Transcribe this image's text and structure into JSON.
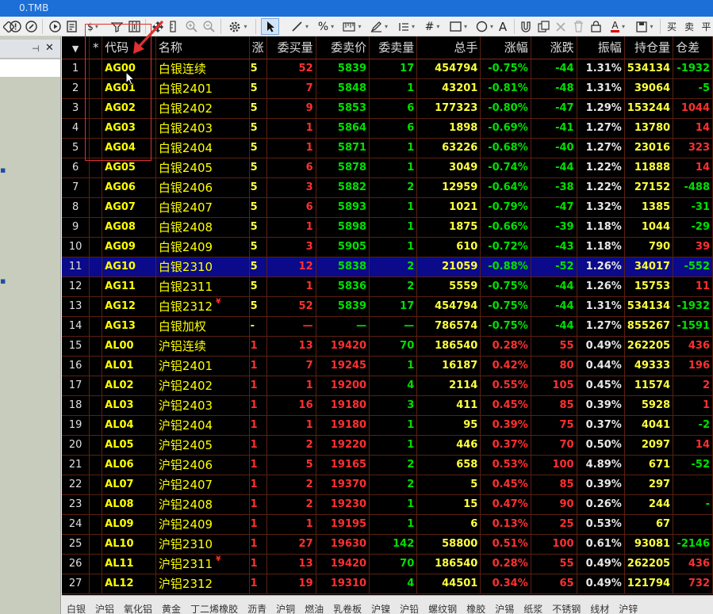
{
  "window": {
    "title": "0.TMB"
  },
  "toolbar": {
    "label_a": "A",
    "label_buy": "买",
    "label_sell": "卖",
    "label_ping": "平"
  },
  "columns": [
    "",
    "*",
    "代码",
    "名称",
    "涨",
    "委买量",
    "委卖价",
    "委卖量",
    "总手",
    "涨幅",
    "涨跌",
    "振幅",
    "持仓量",
    "仓差"
  ],
  "rows": [
    {
      "idx": "1",
      "code": "AG00",
      "name": "白银连续",
      "u": "5",
      "bv": "52",
      "ap": "5839",
      "av": "17",
      "vol": "454794",
      "pct": "-0.75%",
      "chg": "-44",
      "amp": "1.31%",
      "oi": "534134",
      "oid": "-1932",
      "flag": ""
    },
    {
      "idx": "2",
      "code": "AG01",
      "name": "白银2401",
      "u": "5",
      "bv": "7",
      "ap": "5848",
      "av": "1",
      "vol": "43201",
      "pct": "-0.81%",
      "chg": "-48",
      "amp": "1.31%",
      "oi": "39064",
      "oid": "-5",
      "flag": ""
    },
    {
      "idx": "3",
      "code": "AG02",
      "name": "白银2402",
      "u": "5",
      "bv": "9",
      "ap": "5853",
      "av": "6",
      "vol": "177323",
      "pct": "-0.80%",
      "chg": "-47",
      "amp": "1.29%",
      "oi": "153244",
      "oid": "1044",
      "flag": ""
    },
    {
      "idx": "4",
      "code": "AG03",
      "name": "白银2403",
      "u": "5",
      "bv": "1",
      "ap": "5864",
      "av": "6",
      "vol": "1898",
      "pct": "-0.69%",
      "chg": "-41",
      "amp": "1.27%",
      "oi": "13780",
      "oid": "14",
      "flag": ""
    },
    {
      "idx": "5",
      "code": "AG04",
      "name": "白银2404",
      "u": "5",
      "bv": "1",
      "ap": "5871",
      "av": "1",
      "vol": "63226",
      "pct": "-0.68%",
      "chg": "-40",
      "amp": "1.27%",
      "oi": "23016",
      "oid": "323",
      "flag": ""
    },
    {
      "idx": "6",
      "code": "AG05",
      "name": "白银2405",
      "u": "5",
      "bv": "6",
      "ap": "5878",
      "av": "1",
      "vol": "3049",
      "pct": "-0.74%",
      "chg": "-44",
      "amp": "1.22%",
      "oi": "11888",
      "oid": "14",
      "flag": ""
    },
    {
      "idx": "7",
      "code": "AG06",
      "name": "白银2406",
      "u": "5",
      "bv": "3",
      "ap": "5882",
      "av": "2",
      "vol": "12959",
      "pct": "-0.64%",
      "chg": "-38",
      "amp": "1.22%",
      "oi": "27152",
      "oid": "-488",
      "flag": ""
    },
    {
      "idx": "8",
      "code": "AG07",
      "name": "白银2407",
      "u": "5",
      "bv": "6",
      "ap": "5893",
      "av": "1",
      "vol": "1021",
      "pct": "-0.79%",
      "chg": "-47",
      "amp": "1.32%",
      "oi": "1385",
      "oid": "-31",
      "flag": ""
    },
    {
      "idx": "9",
      "code": "AG08",
      "name": "白银2408",
      "u": "5",
      "bv": "1",
      "ap": "5898",
      "av": "1",
      "vol": "1875",
      "pct": "-0.66%",
      "chg": "-39",
      "amp": "1.18%",
      "oi": "1044",
      "oid": "-29",
      "flag": ""
    },
    {
      "idx": "10",
      "code": "AG09",
      "name": "白银2409",
      "u": "5",
      "bv": "3",
      "ap": "5905",
      "av": "1",
      "vol": "610",
      "pct": "-0.72%",
      "chg": "-43",
      "amp": "1.18%",
      "oi": "790",
      "oid": "39",
      "flag": ""
    },
    {
      "idx": "11",
      "code": "AG10",
      "name": "白银2310",
      "u": "5",
      "bv": "12",
      "ap": "5838",
      "av": "2",
      "vol": "21059",
      "pct": "-0.88%",
      "chg": "-52",
      "amp": "1.26%",
      "oi": "34017",
      "oid": "-552",
      "flag": ""
    },
    {
      "idx": "12",
      "code": "AG11",
      "name": "白银2311",
      "u": "5",
      "bv": "1",
      "ap": "5836",
      "av": "2",
      "vol": "5559",
      "pct": "-0.75%",
      "chg": "-44",
      "amp": "1.26%",
      "oi": "15753",
      "oid": "11",
      "flag": ""
    },
    {
      "idx": "13",
      "code": "AG12",
      "name": "白银2312",
      "u": "5",
      "bv": "52",
      "ap": "5839",
      "av": "17",
      "vol": "454794",
      "pct": "-0.75%",
      "chg": "-44",
      "amp": "1.31%",
      "oi": "534134",
      "oid": "-1932",
      "flag": "¥"
    },
    {
      "idx": "14",
      "code": "AG13",
      "name": "白银加权",
      "u": "-",
      "bv": "—",
      "ap": "—",
      "av": "—",
      "vol": "786574",
      "pct": "-0.75%",
      "chg": "-44",
      "amp": "1.27%",
      "oi": "855267",
      "oid": "-1591",
      "flag": ""
    },
    {
      "idx": "15",
      "code": "AL00",
      "name": "沪铝连续",
      "u": "1",
      "bv": "13",
      "ap": "19420",
      "av": "70",
      "vol": "186540",
      "pct": "0.28%",
      "chg": "55",
      "amp": "0.49%",
      "oi": "262205",
      "oid": "436",
      "flag": ""
    },
    {
      "idx": "16",
      "code": "AL01",
      "name": "沪铝2401",
      "u": "1",
      "bv": "7",
      "ap": "19245",
      "av": "1",
      "vol": "16187",
      "pct": "0.42%",
      "chg": "80",
      "amp": "0.44%",
      "oi": "49333",
      "oid": "196",
      "flag": ""
    },
    {
      "idx": "17",
      "code": "AL02",
      "name": "沪铝2402",
      "u": "1",
      "bv": "1",
      "ap": "19200",
      "av": "4",
      "vol": "2114",
      "pct": "0.55%",
      "chg": "105",
      "amp": "0.45%",
      "oi": "11574",
      "oid": "2",
      "flag": ""
    },
    {
      "idx": "18",
      "code": "AL03",
      "name": "沪铝2403",
      "u": "1",
      "bv": "16",
      "ap": "19180",
      "av": "3",
      "vol": "411",
      "pct": "0.45%",
      "chg": "85",
      "amp": "0.39%",
      "oi": "5928",
      "oid": "1",
      "flag": ""
    },
    {
      "idx": "19",
      "code": "AL04",
      "name": "沪铝2404",
      "u": "1",
      "bv": "1",
      "ap": "19180",
      "av": "1",
      "vol": "95",
      "pct": "0.39%",
      "chg": "75",
      "amp": "0.37%",
      "oi": "4041",
      "oid": "-2",
      "flag": ""
    },
    {
      "idx": "20",
      "code": "AL05",
      "name": "沪铝2405",
      "u": "1",
      "bv": "2",
      "ap": "19220",
      "av": "1",
      "vol": "446",
      "pct": "0.37%",
      "chg": "70",
      "amp": "0.50%",
      "oi": "2097",
      "oid": "14",
      "flag": ""
    },
    {
      "idx": "21",
      "code": "AL06",
      "name": "沪铝2406",
      "u": "1",
      "bv": "5",
      "ap": "19165",
      "av": "2",
      "vol": "658",
      "pct": "0.53%",
      "chg": "100",
      "amp": "4.89%",
      "oi": "671",
      "oid": "-52",
      "flag": ""
    },
    {
      "idx": "22",
      "code": "AL07",
      "name": "沪铝2407",
      "u": "1",
      "bv": "2",
      "ap": "19370",
      "av": "2",
      "vol": "5",
      "pct": "0.45%",
      "chg": "85",
      "amp": "0.39%",
      "oi": "297",
      "oid": "",
      "flag": ""
    },
    {
      "idx": "23",
      "code": "AL08",
      "name": "沪铝2408",
      "u": "1",
      "bv": "2",
      "ap": "19230",
      "av": "1",
      "vol": "15",
      "pct": "0.47%",
      "chg": "90",
      "amp": "0.26%",
      "oi": "244",
      "oid": "-",
      "flag": ""
    },
    {
      "idx": "24",
      "code": "AL09",
      "name": "沪铝2409",
      "u": "1",
      "bv": "1",
      "ap": "19195",
      "av": "1",
      "vol": "6",
      "pct": "0.13%",
      "chg": "25",
      "amp": "0.53%",
      "oi": "67",
      "oid": "",
      "flag": ""
    },
    {
      "idx": "25",
      "code": "AL10",
      "name": "沪铝2310",
      "u": "1",
      "bv": "27",
      "ap": "19630",
      "av": "142",
      "vol": "58800",
      "pct": "0.51%",
      "chg": "100",
      "amp": "0.61%",
      "oi": "93081",
      "oid": "-2146",
      "flag": ""
    },
    {
      "idx": "26",
      "code": "AL11",
      "name": "沪铝2311",
      "u": "1",
      "bv": "13",
      "ap": "19420",
      "av": "70",
      "vol": "186540",
      "pct": "0.28%",
      "chg": "55",
      "amp": "0.49%",
      "oi": "262205",
      "oid": "436",
      "flag": "¥"
    },
    {
      "idx": "27",
      "code": "AL12",
      "name": "沪铝2312",
      "u": "1",
      "bv": "19",
      "ap": "19310",
      "av": "4",
      "vol": "44501",
      "pct": "0.34%",
      "chg": "65",
      "amp": "0.49%",
      "oi": "121794",
      "oid": "732",
      "flag": ""
    }
  ],
  "selected_row": "11",
  "bottom_tabs": [
    "白银",
    "沪铝",
    "氧化铝",
    "黄金",
    "丁二烯橡胶",
    "沥青",
    "沪铜",
    "燃油",
    "乳卷板",
    "沪镍",
    "沪铅",
    "螺纹钢",
    "橡胶",
    "沪锡",
    "纸浆",
    "不锈钢",
    "线材",
    "沪锌"
  ],
  "colors": {
    "up": "#ff3030",
    "down": "#00e000",
    "code": "#ffff00",
    "selected": "#0a0a8a",
    "annotation": "#e03030"
  },
  "icons": [
    "alert-icon",
    "edit-icon",
    "play-icon",
    "doc-icon",
    "dollar-icon",
    "filter-icon",
    "grid-icon",
    "move-icon",
    "zoom-in-icon",
    "zoom-out-icon",
    "settings-icon",
    "pointer-icon",
    "line-icon",
    "percent-icon",
    "ruler-icon",
    "pen-icon",
    "list-icon",
    "hash-icon",
    "rect-icon",
    "circle-icon",
    "magnet-icon",
    "copy-icon",
    "close-icon",
    "trash-icon",
    "lock-icon",
    "font-color-icon",
    "save-icon"
  ]
}
